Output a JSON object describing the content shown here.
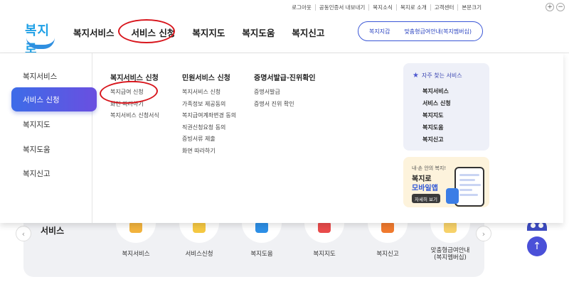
{
  "utility": {
    "links": [
      "로그아웃",
      "공동인증서 내보내기",
      "복지소식",
      "복지로 소개",
      "고객센터",
      "본문크기"
    ],
    "zoom_in": "+",
    "zoom_out": "−"
  },
  "logo": {
    "text": "복지로"
  },
  "gnb": {
    "items": [
      "복지서비스",
      "서비스 신청",
      "복지지도",
      "복지도움",
      "복지신고"
    ]
  },
  "header_button": {
    "left": "복지지갑",
    "right": "맞춤형급여안내(복지멤버십)"
  },
  "sidebar": {
    "items": [
      "복지서비스",
      "서비스 신청",
      "복지지도",
      "복지도움",
      "복지신고"
    ]
  },
  "columns": [
    {
      "heading": "복지서비스 신청",
      "items": [
        "복지급여 신청",
        "화면 따라하기",
        "복지서비스 신청서식"
      ]
    },
    {
      "heading": "민원서비스 신청",
      "items": [
        "복지서비스 신청",
        "가족정보 제공동의",
        "복지급여계좌변경 동의",
        "직권신청요청 동의",
        "증빙서류 제출",
        "화면 따라하기"
      ]
    },
    {
      "heading": "증명서발급·진위확인",
      "items": [
        "증명서발급",
        "증명서 진위 확인"
      ]
    }
  ],
  "favorites": {
    "heading": "자주 찾는 서비스",
    "items": [
      "복지서비스",
      "서비스 신청",
      "복지지도",
      "복지도움",
      "복지신고"
    ]
  },
  "app_banner": {
    "subtitle": "내·손 안의 복지!",
    "title1": "복지로",
    "title2": "모바일앱",
    "button": "자세히 보기"
  },
  "services": {
    "title": "서비스",
    "items": [
      {
        "label": "복지서비스",
        "color": "#f2b33d"
      },
      {
        "label": "서비스신청",
        "color": "#f5c842"
      },
      {
        "label": "복지도움",
        "color": "#2d8fe6"
      },
      {
        "label": "복지지도",
        "color": "#e94b4b"
      },
      {
        "label": "복지신고",
        "color": "#f07a2e"
      },
      {
        "label": "맞춤형급여안내\n(복지멤버십)",
        "color": "#f7d26a"
      }
    ]
  },
  "colors": {
    "accent": "#3d5ce6",
    "highlight": "#d8151c"
  }
}
